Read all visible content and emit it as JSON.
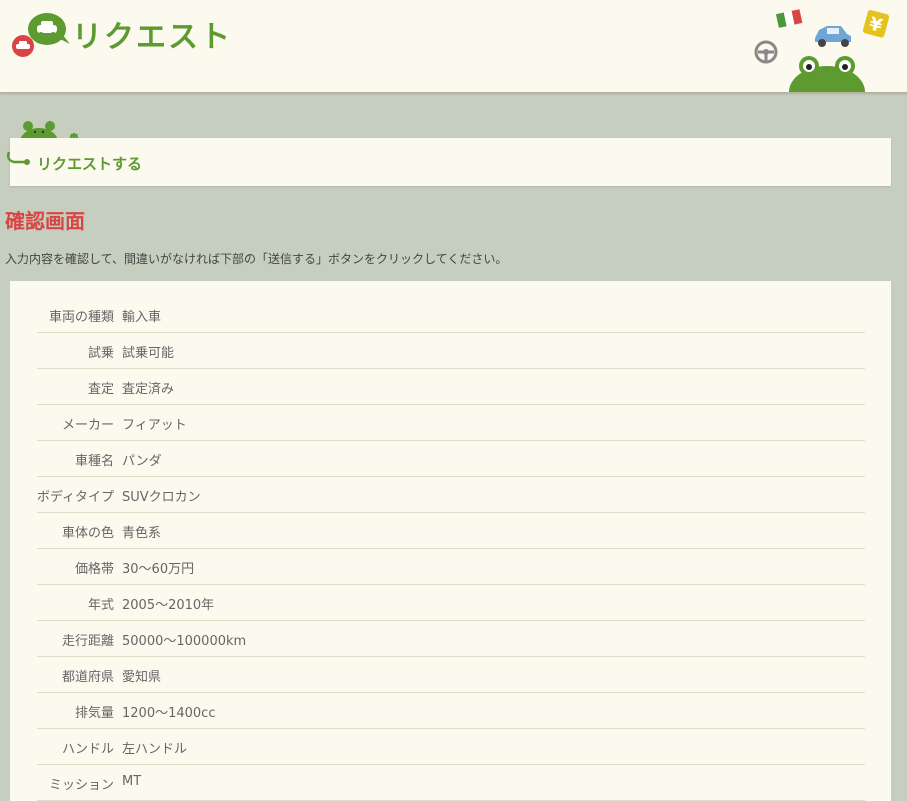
{
  "header": {
    "title": "リクエスト"
  },
  "section": {
    "title": "リクエストする"
  },
  "confirm": {
    "heading": "確認画面",
    "instruction": "入力内容を確認して、間違いがなければ下部の「送信する」ボタンをクリックしてください。"
  },
  "rows": [
    {
      "label": "車両の種類",
      "value": "輸入車"
    },
    {
      "label": "試乗",
      "value": "試乗可能"
    },
    {
      "label": "査定",
      "value": "査定済み"
    },
    {
      "label": "メーカー",
      "value": "フィアット"
    },
    {
      "label": "車種名",
      "value": "パンダ"
    },
    {
      "label": "ボディタイプ",
      "value": "SUVクロカン"
    },
    {
      "label": "車体の色",
      "value": "青色系"
    },
    {
      "label": "価格帯",
      "value": "30～60万円"
    },
    {
      "label": "年式",
      "value": "2005～2010年"
    },
    {
      "label": "走行距離",
      "value": "50000～100000km"
    },
    {
      "label": "都道府県",
      "value": "愛知県"
    },
    {
      "label": "排気量",
      "value": "1200～1400cc"
    },
    {
      "label": "ハンドル",
      "value": "左ハンドル"
    },
    {
      "label": "ミッション",
      "value": "MT"
    }
  ],
  "colors": {
    "brand_green": "#5d9a2f",
    "heading_red": "#d94545",
    "page_bg": "#c6cfbf",
    "panel_bg": "#fcf9ef"
  },
  "icons": [
    "speech-bubble-car-icon",
    "italian-flag-icon",
    "blue-car-icon",
    "yen-icon",
    "steering-wheel-icon",
    "frog-mascot-icon"
  ]
}
